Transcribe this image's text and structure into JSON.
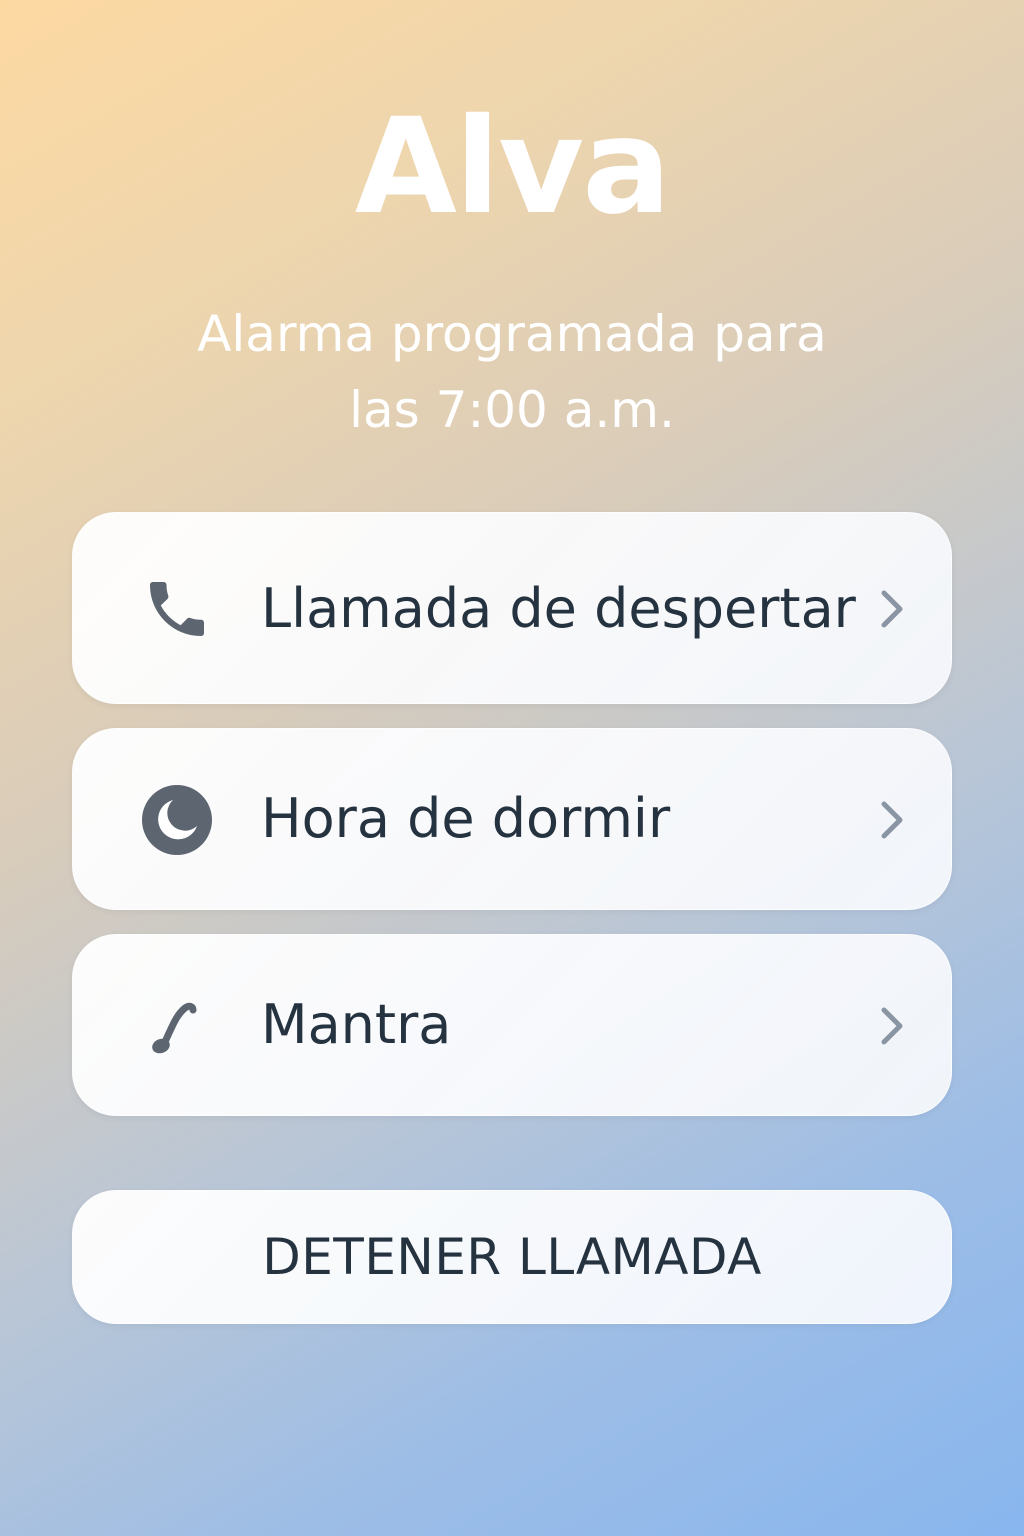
{
  "app": {
    "title": "Alva",
    "subtitle": "Alarma programada para las 7:00 a.m."
  },
  "menu": {
    "items": [
      {
        "label": "Llamada de despertar",
        "icon": "phone-icon"
      },
      {
        "label": "Hora de dormir",
        "icon": "moon-icon"
      },
      {
        "label": "Mantra",
        "icon": "music-note-icon"
      }
    ]
  },
  "actions": {
    "stop_label": "DETENER LLAMADA"
  },
  "colors": {
    "gradient_start": "#fdd9a2",
    "gradient_end": "#88b6ee",
    "text_dark": "#25323f",
    "icon": "#5c6570",
    "chevron": "#8a95a3"
  }
}
